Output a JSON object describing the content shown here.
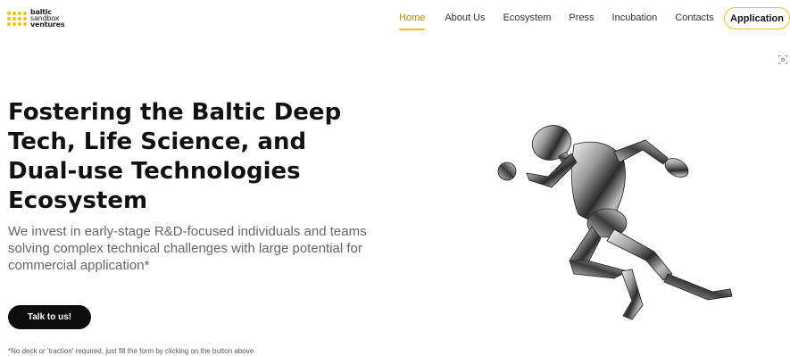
{
  "header": {
    "logo": {
      "line1": "baltic",
      "line2": "sandbox",
      "line3": "ventures"
    },
    "nav": [
      {
        "label": "Home",
        "active": true
      },
      {
        "label": "About Us"
      },
      {
        "label": "Ecosystem"
      },
      {
        "label": "Press"
      },
      {
        "label": "Incubation"
      },
      {
        "label": "Contacts"
      }
    ],
    "application_button": "Application",
    "icons": {
      "scan": "scan-icon"
    }
  },
  "hero": {
    "headline": "Fostering the Baltic Deep Tech, Life Science, and Dual-use Technologies Ecosystem",
    "subheadline": "We invest in early-stage R&D-focused individuals and teams solving complex technical challenges with large potential for commercial application*",
    "cta_button": "Talk to us!",
    "footnote": "*No deck or 'traction' required, just fill the form by clicking on the button above"
  },
  "colors": {
    "accent": "#f2c21b",
    "text": "#111111",
    "muted": "#666666",
    "cta_bg": "#0d0d0d"
  }
}
